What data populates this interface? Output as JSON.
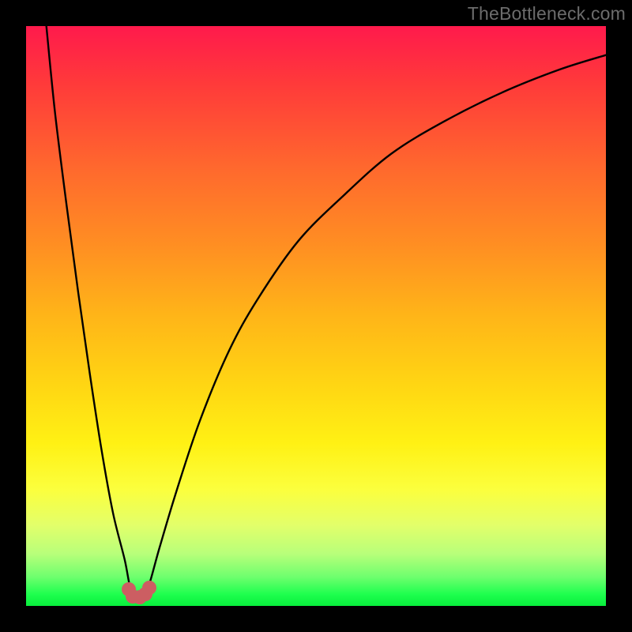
{
  "watermark": "TheBottleneck.com",
  "colors": {
    "frame": "#000000",
    "curve_stroke": "#000000",
    "marker_fill": "#cc5e62",
    "gradient_top": "#ff1a4c",
    "gradient_bottom": "#08ee3c"
  },
  "chart_data": {
    "type": "line",
    "title": "",
    "xlabel": "",
    "ylabel": "",
    "xlim": [
      0,
      100
    ],
    "ylim": [
      0,
      100
    ],
    "x": [
      3.5,
      5,
      7,
      9,
      11,
      13,
      15,
      17,
      18.2,
      19.7,
      21,
      23,
      26,
      30,
      35,
      40,
      47,
      55,
      63,
      72,
      82,
      92,
      100
    ],
    "values": [
      100,
      85,
      69,
      54,
      40,
      27,
      16,
      8,
      2.3,
      1.5,
      3.0,
      10,
      20,
      32,
      44,
      53,
      63,
      71,
      78,
      83.5,
      88.5,
      92.5,
      95
    ],
    "markers": {
      "x": [
        17.7,
        18.4,
        19.6,
        20.6,
        21.2
      ],
      "y": [
        2.8,
        1.6,
        1.5,
        2.0,
        3.2
      ]
    },
    "notes": "V-shaped bottleneck curve on rainbow heat-gradient background. Minimum near x≈19, y≈1.5. Axes unlabeled; values estimated from pixel positions on a 0–100 normalized scale."
  }
}
